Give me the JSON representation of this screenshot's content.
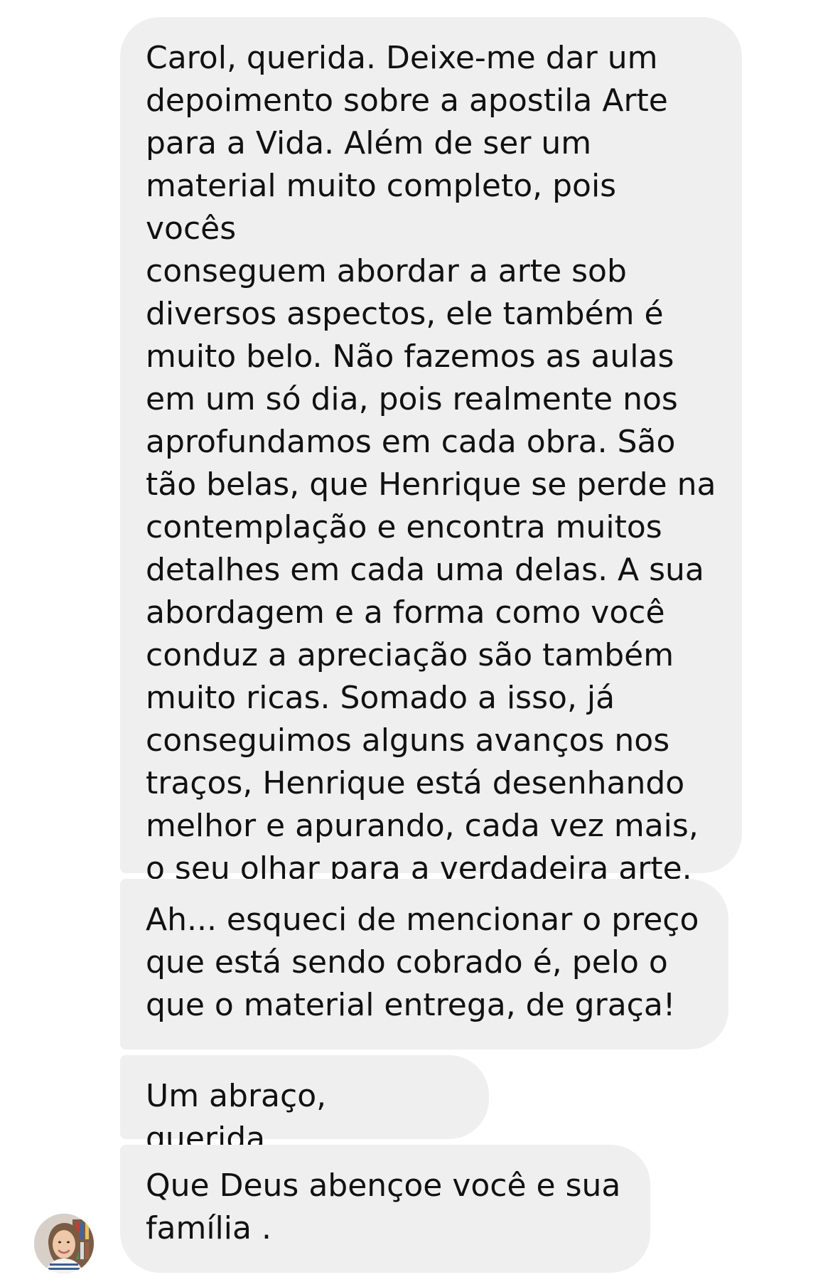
{
  "messages": [
    {
      "text": "Carol, querida. Deixe-me dar um\ndepoimento sobre a apostila Arte\npara a Vida. Além de ser um\nmaterial muito completo, pois vocês\nconseguem abordar a arte sob\ndiversos aspectos, ele também é\nmuito belo. Não fazemos as aulas\nem um só dia, pois realmente nos\naprofundamos em cada obra. São\ntão belas, que Henrique se perde na\ncontemplação e encontra muitos\ndetalhes em cada uma delas. A sua\nabordagem e a forma como você\nconduz a apreciação são também\nmuito ricas. Somado a isso, já\nconseguimos alguns avanços nos\ntraços, Henrique está desenhando\nmelhor e apurando, cada vez mais,\no seu olhar para a verdadeira arte."
    },
    {
      "text": "Ah... esqueci de mencionar o preço\nque está sendo cobrado é, pelo o\nque o material entrega, de graça!"
    },
    {
      "text": "Um abraço, querida."
    },
    {
      "text": "Que Deus abençoe você e sua\nfamília ."
    }
  ],
  "colors": {
    "bubble_background": "#efeff0",
    "text": "#111111",
    "page_background": "#ffffff"
  },
  "icons": {
    "sender_avatar": "avatar-icon"
  }
}
